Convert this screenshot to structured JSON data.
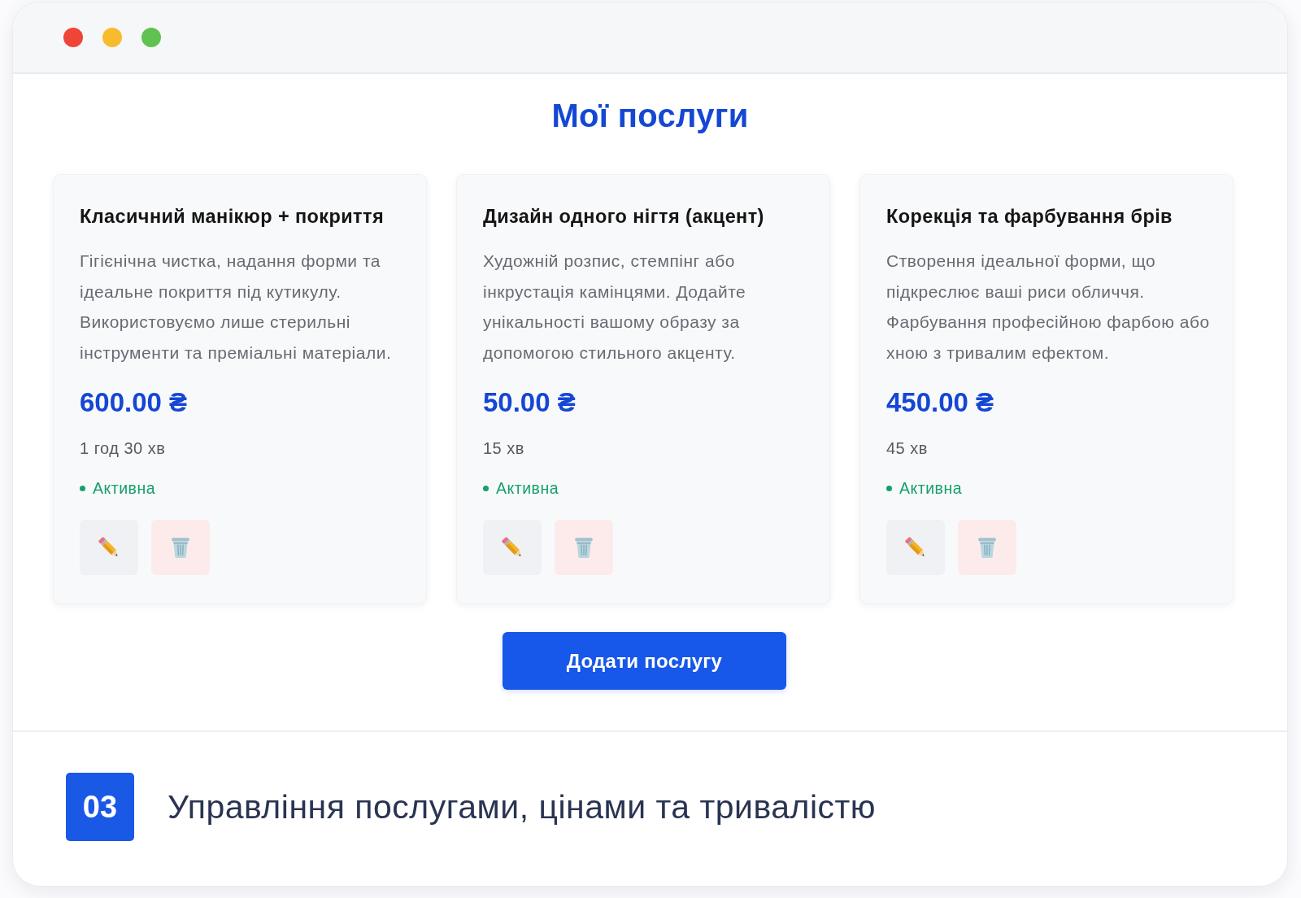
{
  "heading": "Мої послуги",
  "services": [
    {
      "name": "Класичний манікюр + покриття",
      "description": "Гігієнічна чистка, надання форми та ідеальне покриття під кутикулу. Використовуємо лише стерильні інструменти та преміальні матеріали.",
      "price": "600.00 ₴",
      "duration": "1 год 30 хв",
      "status": "Активна",
      "active": true
    },
    {
      "name": "Дизайн одного нігтя (акцент)",
      "description": "Художній розпис, стемпінг або інкрустація камінцями. Додайте унікальності вашому образу за допомогою стильного акценту.",
      "price": "50.00 ₴",
      "duration": "15 хв",
      "status": "Активна",
      "active": true
    },
    {
      "name": "Корекція та фарбування брів",
      "description": "Створення ідеальної форми, що підкреслює ваші риси обличчя. Фарбування професійною фарбою або хною з тривалим ефектом.",
      "price": "450.00 ₴",
      "duration": "45 хв",
      "status": "Активна",
      "active": true
    }
  ],
  "add_button": "Додати послугу",
  "caption": {
    "number": "03",
    "text": "Управління послугами, цінами та тривалістю"
  }
}
